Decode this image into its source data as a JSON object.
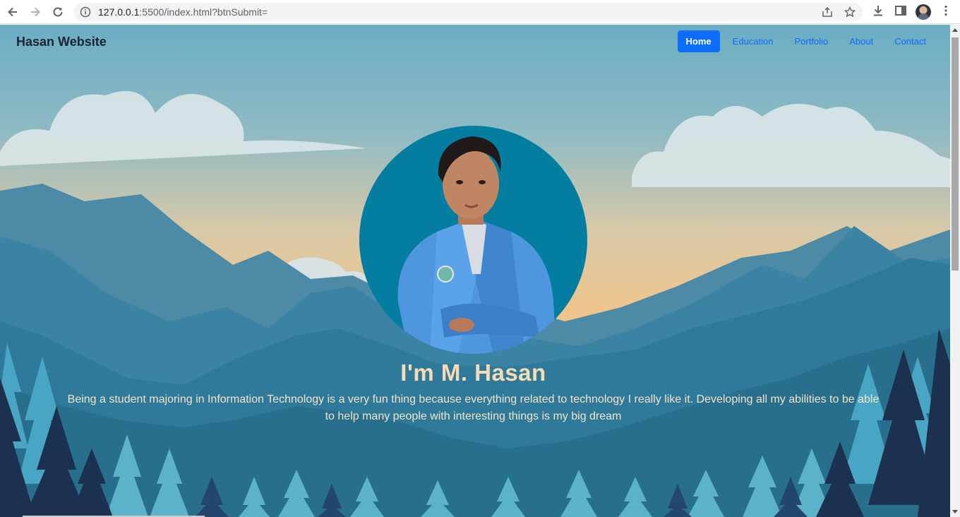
{
  "browser": {
    "url_host": "127.0.0.1",
    "url_path": ":5500/index.html?btnSubmit="
  },
  "site": {
    "brand": "Hasan Website",
    "nav": [
      {
        "label": "Home",
        "active": true
      },
      {
        "label": "Education",
        "active": false
      },
      {
        "label": "Portfolio",
        "active": false
      },
      {
        "label": "About",
        "active": false
      },
      {
        "label": "Contact",
        "active": false
      }
    ]
  },
  "hero": {
    "title": "I'm M. Hasan",
    "description": "Being a student majoring in Information Technology is a very fun thing because everything related to technology I really like it. Developing all my abilities to be able to help many people with interesting things is my big dream"
  },
  "colors": {
    "accent": "#0d6efd",
    "portrait_bg": "#037da0",
    "title": "#f6dcb4"
  }
}
